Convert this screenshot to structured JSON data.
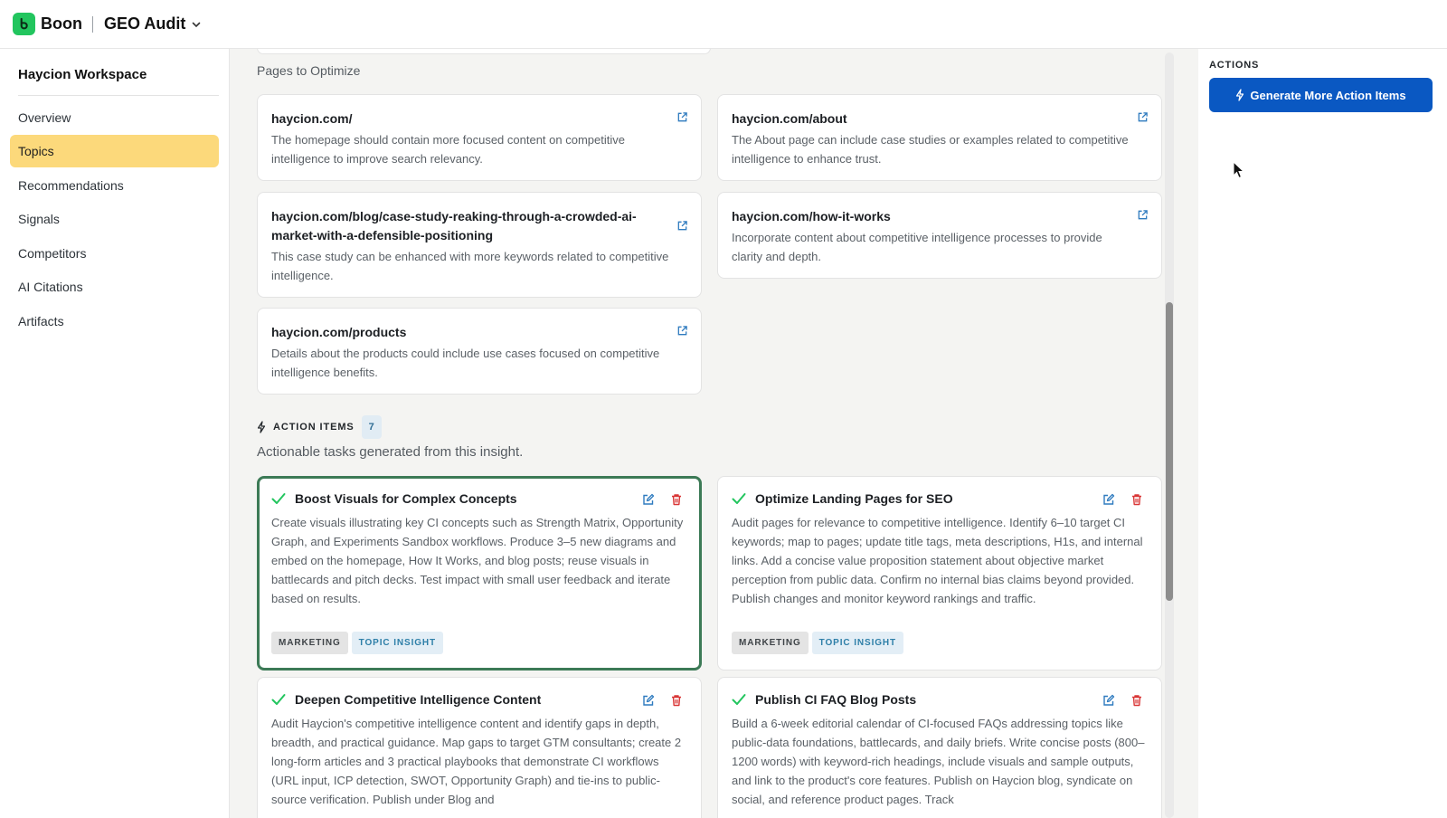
{
  "app": {
    "brand": "Boon",
    "project": "GEO Audit"
  },
  "sidebar": {
    "workspace": "Haycion Workspace",
    "items": [
      {
        "label": "Overview",
        "active": false
      },
      {
        "label": "Topics",
        "active": true
      },
      {
        "label": "Recommendations",
        "active": false
      },
      {
        "label": "Signals",
        "active": false
      },
      {
        "label": "Competitors",
        "active": false
      },
      {
        "label": "AI Citations",
        "active": false
      },
      {
        "label": "Artifacts",
        "active": false
      }
    ]
  },
  "pages": {
    "label": "Pages to Optimize",
    "items": [
      {
        "url": "haycion.com/",
        "desc": "The homepage should contain more focused content on competitive intelligence to improve search relevancy."
      },
      {
        "url": "haycion.com/about",
        "desc": "The About page can include case studies or examples related to competitive intelligence to enhance trust."
      },
      {
        "url": "haycion.com/blog/case-study-reaking-through-a-crowded-ai-market-with-a-defensible-positioning",
        "desc": "This case study can be enhanced with more keywords related to competitive intelligence."
      },
      {
        "url": "haycion.com/how-it-works",
        "desc": "Incorporate content about competitive intelligence processes to provide clarity and depth."
      },
      {
        "url": "haycion.com/products",
        "desc": "Details about the products could include use cases focused on competitive intelligence benefits."
      }
    ]
  },
  "action_items": {
    "label": "ACTION ITEMS",
    "count": "7",
    "subtitle": "Actionable tasks generated from this insight.",
    "items": [
      {
        "title": "Boost Visuals for Complex Concepts",
        "desc": "Create visuals illustrating key CI concepts such as Strength Matrix, Opportunity Graph, and Experiments Sandbox workflows. Produce 3–5 new diagrams and embed on the homepage, How It Works, and blog posts; reuse visuals in battlecards and pitch decks. Test impact with small user feedback and iterate based on results.",
        "tags": [
          "MARKETING",
          "TOPIC INSIGHT"
        ]
      },
      {
        "title": "Optimize Landing Pages for SEO",
        "desc": "Audit pages for relevance to competitive intelligence. Identify 6–10 target CI keywords; map to pages; update title tags, meta descriptions, H1s, and internal links. Add a concise value proposition statement about objective market perception from public data. Confirm no internal bias claims beyond provided. Publish changes and monitor keyword rankings and traffic.",
        "tags": [
          "MARKETING",
          "TOPIC INSIGHT"
        ]
      },
      {
        "title": "Deepen Competitive Intelligence Content",
        "desc": "Audit Haycion's competitive intelligence content and identify gaps in depth, breadth, and practical guidance. Map gaps to target GTM consultants; create 2 long-form articles and 3 practical playbooks that demonstrate CI workflows (URL input, ICP detection, SWOT, Opportunity Graph) and tie-ins to public-source verification. Publish under Blog and"
      },
      {
        "title": "Publish CI FAQ Blog Posts",
        "desc": "Build a 6-week editorial calendar of CI-focused FAQs addressing topics like public-data foundations, battlecards, and daily briefs. Write concise posts (800–1200 words) with keyword-rich headings, include visuals and sample outputs, and link to the product's core features. Publish on Haycion blog, syndicate on social, and reference product pages. Track"
      }
    ]
  },
  "right_panel": {
    "label": "ACTIONS",
    "button": "Generate More Action Items"
  },
  "colors": {
    "accent": "#0a58c2",
    "active_nav": "#fcd97b",
    "success": "#22c55e",
    "danger": "#d93636"
  }
}
